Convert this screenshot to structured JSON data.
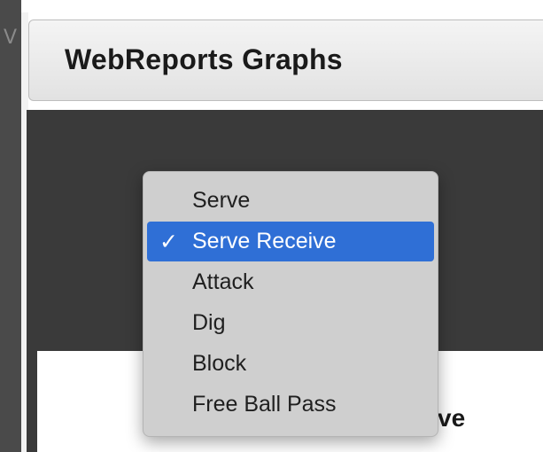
{
  "left_fragment": "V",
  "window": {
    "title": "WebReports Graphs"
  },
  "partial_text": "ve",
  "dropdown": {
    "items": [
      {
        "label": "Serve",
        "selected": false
      },
      {
        "label": "Serve Receive",
        "selected": true
      },
      {
        "label": "Attack",
        "selected": false
      },
      {
        "label": "Dig",
        "selected": false
      },
      {
        "label": "Block",
        "selected": false
      },
      {
        "label": "Free Ball Pass",
        "selected": false
      }
    ],
    "check_glyph": "✓"
  },
  "colors": {
    "selection": "#2f6fd6",
    "dark_background": "#3a3a3a"
  }
}
